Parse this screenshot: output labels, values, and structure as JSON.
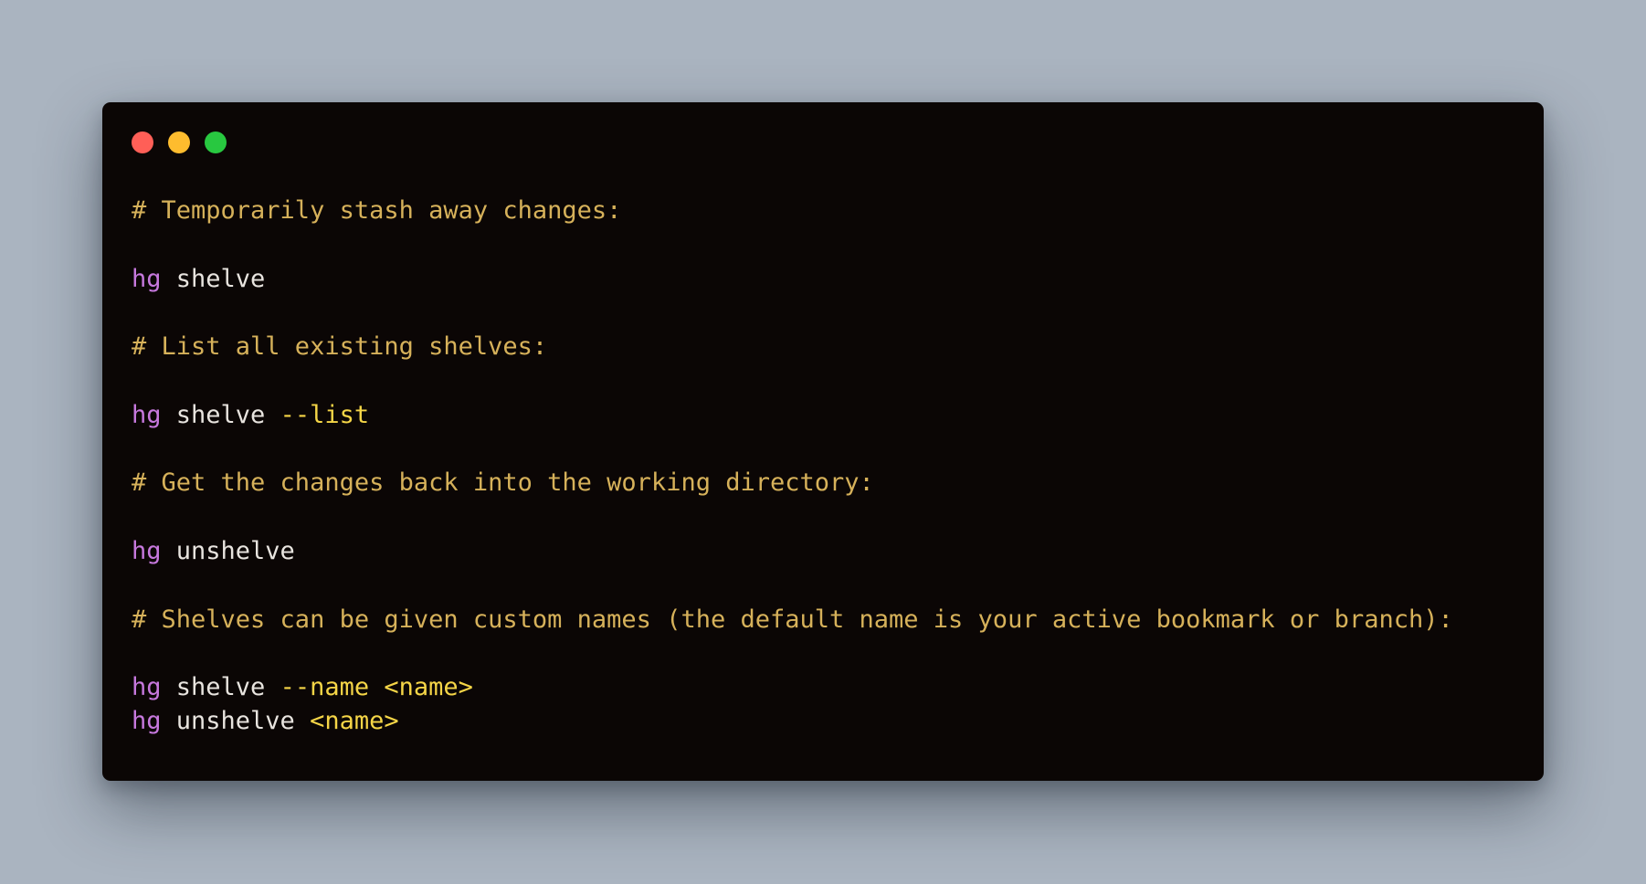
{
  "window": {
    "controls": [
      {
        "name": "close",
        "color": "#ff5f57"
      },
      {
        "name": "minimize",
        "color": "#febc2e"
      },
      {
        "name": "maximize",
        "color": "#28c840"
      }
    ]
  },
  "colors": {
    "background": "#aab4c0",
    "window": "#0b0605",
    "comment": "#d6b15a",
    "command": "#c678dd",
    "text": "#e8e4df",
    "flag": "#f5d547"
  },
  "code": [
    [
      {
        "t": "# Temporarily stash away changes:",
        "k": "comment"
      }
    ],
    [],
    [
      {
        "t": "hg",
        "k": "command"
      },
      {
        "t": " shelve",
        "k": "text"
      }
    ],
    [],
    [
      {
        "t": "# List all existing shelves:",
        "k": "comment"
      }
    ],
    [],
    [
      {
        "t": "hg",
        "k": "command"
      },
      {
        "t": " shelve ",
        "k": "text"
      },
      {
        "t": "--list",
        "k": "flag"
      }
    ],
    [],
    [
      {
        "t": "# Get the changes back into the working directory:",
        "k": "comment"
      }
    ],
    [],
    [
      {
        "t": "hg",
        "k": "command"
      },
      {
        "t": " unshelve",
        "k": "text"
      }
    ],
    [],
    [
      {
        "t": "# Shelves can be given custom names (the default name is your active bookmark or branch):",
        "k": "comment"
      }
    ],
    [],
    [
      {
        "t": "hg",
        "k": "command"
      },
      {
        "t": " shelve ",
        "k": "text"
      },
      {
        "t": "--name <name>",
        "k": "flag"
      }
    ],
    [
      {
        "t": "hg",
        "k": "command"
      },
      {
        "t": " unshelve ",
        "k": "text"
      },
      {
        "t": "<name>",
        "k": "flag"
      }
    ]
  ]
}
